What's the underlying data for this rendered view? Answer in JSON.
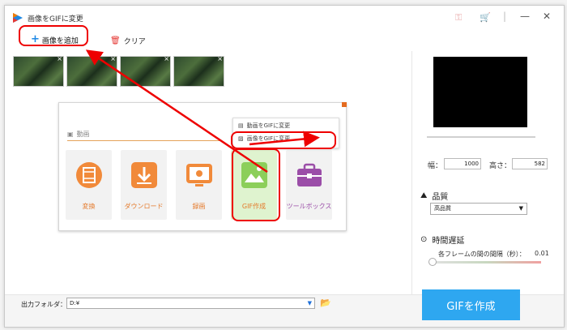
{
  "window": {
    "title": "画像をGIFに変更",
    "icons": [
      "key-icon",
      "cart-icon"
    ],
    "controls": [
      "minimize",
      "close"
    ]
  },
  "toolbar": {
    "add_label": "画像を追加",
    "clear_label": "クリア"
  },
  "thumbnails": [
    {
      "close": "×"
    },
    {
      "close": "×"
    },
    {
      "close": "×"
    },
    {
      "close": "×"
    }
  ],
  "embedded": {
    "section_label": "動画",
    "menu_items": [
      "動画をGIFに変更",
      "画像をGIFに変更"
    ],
    "tiles": [
      {
        "label": "変換",
        "color": "#f18a3a"
      },
      {
        "label": "ダウンロード",
        "color": "#f18a3a"
      },
      {
        "label": "録画",
        "color": "#f18a3a"
      },
      {
        "label": "GIF作成",
        "color": "#8ccf5a"
      },
      {
        "label": "ツールボックス",
        "color": "#9b4ea8"
      }
    ]
  },
  "right": {
    "width_label": "幅：",
    "width_value": "1000",
    "height_label": "高さ：",
    "height_value": "582",
    "quality_label": "品質",
    "quality_value": "高品質",
    "delay_label": "時間遅延",
    "frame_interval_label": "各フレームの間の間隔（秒）：",
    "frame_interval_value": "0.01"
  },
  "bottom": {
    "output_label": "出力フォルダ：",
    "output_value": "D:¥",
    "create_button": "GIFを作成"
  },
  "colors": {
    "accent": "#2ea7f0",
    "highlight": "#ee0000"
  }
}
